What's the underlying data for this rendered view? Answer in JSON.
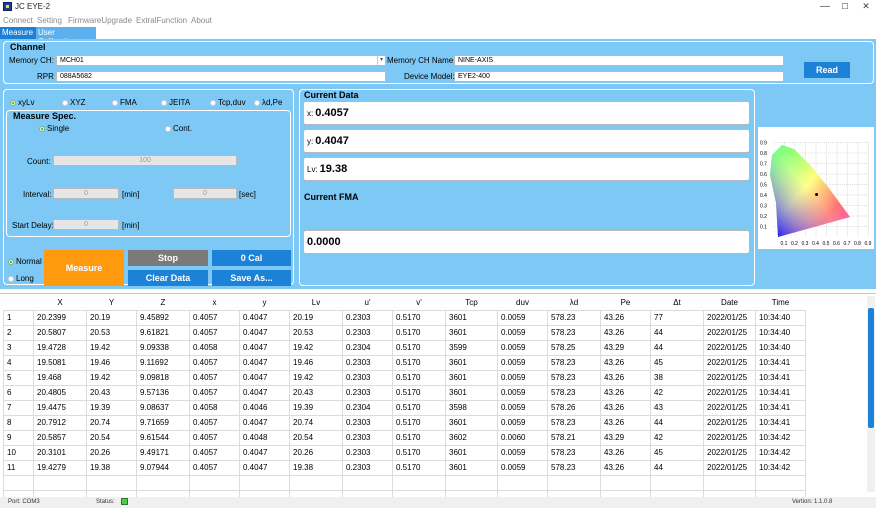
{
  "window": {
    "title": "JC EYE-2",
    "minimize": "—",
    "maximize": "☐",
    "close": "✕"
  },
  "menu": [
    "Connect",
    "Setting",
    "FirmwareUpgrade",
    "ExtralFunction",
    "About"
  ],
  "tabs": [
    "Measure",
    "User Calibration"
  ],
  "channel": {
    "title": "Channel",
    "memory_ch_label": "Memory CH:",
    "memory_ch_value": "MCH01",
    "rpr_tag_label": "RPR Tag:",
    "rpr_tag_value": "088A5682",
    "memory_ch_name_label": "Memory CH Name:",
    "memory_ch_name_value": "NINE-AXIS",
    "device_model_label": "Device Model:",
    "device_model_value": "EYE2-400",
    "read_button": "Read"
  },
  "modes": [
    "xyLv",
    "XYZ",
    "FMA",
    "JEITA",
    "Tcp,duv",
    "λd,Pe"
  ],
  "measure_spec": {
    "title": "Measure Spec.",
    "single": "Single",
    "cont": "Cont.",
    "count_label": "Count:",
    "count_value": "100",
    "interval_label": "Interval:",
    "interval_min": "0",
    "interval_sec": "0",
    "min_unit": "[min]",
    "sec_unit": "[sec]",
    "start_delay_label": "Start Delay:",
    "start_delay_value": "0"
  },
  "controls": {
    "normal": "Normal",
    "long": "Long",
    "measure": "Measure",
    "stop": "Stop",
    "zero_cal": "0 Cal",
    "clear_data": "Clear Data",
    "save_as": "Save As..."
  },
  "current_data": {
    "title": "Current Data",
    "x_label": "x:",
    "x_value": "0.4057",
    "y_label": "y:",
    "y_value": "0.4047",
    "lv_label": "Lv:",
    "lv_value": "19.38"
  },
  "current_fma": {
    "title": "Current FMA",
    "value": "0.0000"
  },
  "cie": {
    "y_ticks": [
      "0.9",
      "0.8",
      "0.7",
      "0.6",
      "0.5",
      "0.4",
      "0.3",
      "0.2",
      "0.1"
    ],
    "x_ticks": [
      "0.1",
      "0.2",
      "0.3",
      "0.4",
      "0.5",
      "0.6",
      "0.7",
      "0.8",
      "0.9"
    ],
    "point": {
      "x": 0.4057,
      "y": 0.4047
    }
  },
  "table": {
    "headers": [
      "",
      "X",
      "Y",
      "Z",
      "x",
      "y",
      "Lv",
      "u'",
      "v'",
      "Tcp",
      "duv",
      "λd",
      "Pe",
      "Δt",
      "Date",
      "Time"
    ],
    "rows": [
      [
        "1",
        "20.2399",
        "20.19",
        "9.45892",
        "0.4057",
        "0.4047",
        "20.19",
        "0.2303",
        "0.5170",
        "3601",
        "0.0059",
        "578.23",
        "43.26",
        "77",
        "2022/01/25",
        "10:34:40"
      ],
      [
        "2",
        "20.5807",
        "20.53",
        "9.61821",
        "0.4057",
        "0.4047",
        "20.53",
        "0.2303",
        "0.5170",
        "3601",
        "0.0059",
        "578.23",
        "43.26",
        "44",
        "2022/01/25",
        "10:34:40"
      ],
      [
        "3",
        "19.4728",
        "19.42",
        "9.09338",
        "0.4058",
        "0.4047",
        "19.42",
        "0.2304",
        "0.5170",
        "3599",
        "0.0059",
        "578.25",
        "43.29",
        "44",
        "2022/01/25",
        "10:34:40"
      ],
      [
        "4",
        "19.5081",
        "19.46",
        "9.11692",
        "0.4057",
        "0.4047",
        "19.46",
        "0.2303",
        "0.5170",
        "3601",
        "0.0059",
        "578.23",
        "43.26",
        "45",
        "2022/01/25",
        "10:34:41"
      ],
      [
        "5",
        "19.468",
        "19.42",
        "9.09818",
        "0.4057",
        "0.4047",
        "19.42",
        "0.2303",
        "0.5170",
        "3601",
        "0.0059",
        "578.23",
        "43.26",
        "38",
        "2022/01/25",
        "10:34:41"
      ],
      [
        "6",
        "20.4805",
        "20.43",
        "9.57136",
        "0.4057",
        "0.4047",
        "20.43",
        "0.2303",
        "0.5170",
        "3601",
        "0.0059",
        "578.23",
        "43.26",
        "42",
        "2022/01/25",
        "10:34:41"
      ],
      [
        "7",
        "19.4475",
        "19.39",
        "9.08637",
        "0.4058",
        "0.4046",
        "19.39",
        "0.2304",
        "0.5170",
        "3598",
        "0.0059",
        "578.26",
        "43.26",
        "43",
        "2022/01/25",
        "10:34:41"
      ],
      [
        "8",
        "20.7912",
        "20.74",
        "9.71659",
        "0.4057",
        "0.4047",
        "20.74",
        "0.2303",
        "0.5170",
        "3601",
        "0.0059",
        "578.23",
        "43.26",
        "44",
        "2022/01/25",
        "10:34:41"
      ],
      [
        "9",
        "20.5857",
        "20.54",
        "9.61544",
        "0.4057",
        "0.4048",
        "20.54",
        "0.2303",
        "0.5170",
        "3602",
        "0.0060",
        "578.21",
        "43.29",
        "42",
        "2022/01/25",
        "10:34:42"
      ],
      [
        "10",
        "20.3101",
        "20.26",
        "9.49171",
        "0.4057",
        "0.4047",
        "20.26",
        "0.2303",
        "0.5170",
        "3601",
        "0.0059",
        "578.23",
        "43.26",
        "45",
        "2022/01/25",
        "10:34:42"
      ],
      [
        "11",
        "19.4279",
        "19.38",
        "9.07944",
        "0.4057",
        "0.4047",
        "19.38",
        "0.2303",
        "0.5170",
        "3601",
        "0.0059",
        "578.23",
        "43.26",
        "44",
        "2022/01/25",
        "10:34:42"
      ]
    ]
  },
  "statusbar": {
    "port": "Port: COM3",
    "status": "Status:",
    "version": "Vertion: 1.1.0.8"
  },
  "colors": {
    "panel_bg": "#7ec8f5",
    "button_blue": "#1c82d8",
    "measure_orange": "#ff9a0e",
    "gray_button": "#7a7a7a"
  }
}
